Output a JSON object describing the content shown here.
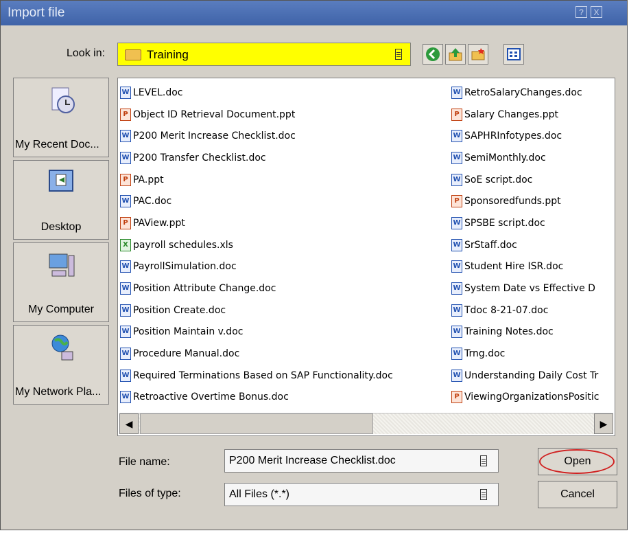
{
  "dialog": {
    "title": "Import file",
    "help_label": "?",
    "close_label": "X"
  },
  "lookin": {
    "label": "Look in:",
    "value": "Training",
    "highlight_color": "#ffff00"
  },
  "toolbar": {
    "back_icon": "back-arrow-icon",
    "up_icon": "up-folder-icon",
    "new_folder_icon": "new-folder-icon",
    "views_icon": "views-menu-icon"
  },
  "places": [
    {
      "label": "My Recent Doc...",
      "icon": "recent-documents-icon"
    },
    {
      "label": "Desktop",
      "icon": "desktop-icon"
    },
    {
      "label": "My Computer",
      "icon": "my-computer-icon"
    },
    {
      "label": "My Network Pla...",
      "icon": "network-places-icon"
    }
  ],
  "files_col1": [
    {
      "name": "LEVEL.doc",
      "type": "word"
    },
    {
      "name": "Object ID Retrieval Document.ppt",
      "type": "ppt"
    },
    {
      "name": "P200 Merit Increase Checklist.doc",
      "type": "word"
    },
    {
      "name": "P200 Transfer Checklist.doc",
      "type": "word"
    },
    {
      "name": "PA.ppt",
      "type": "ppt"
    },
    {
      "name": "PAC.doc",
      "type": "word"
    },
    {
      "name": "PAView.ppt",
      "type": "ppt"
    },
    {
      "name": "payroll schedules.xls",
      "type": "xls"
    },
    {
      "name": "PayrollSimulation.doc",
      "type": "word"
    },
    {
      "name": "Position Attribute Change.doc",
      "type": "word"
    },
    {
      "name": "Position Create.doc",
      "type": "word"
    },
    {
      "name": "Position Maintain v.doc",
      "type": "word"
    },
    {
      "name": "Procedure Manual.doc",
      "type": "word"
    },
    {
      "name": "Required Terminations Based on SAP Functionality.doc",
      "type": "word"
    },
    {
      "name": "Retroactive Overtime Bonus.doc",
      "type": "word"
    }
  ],
  "files_col2": [
    {
      "name": "RetroSalaryChanges.doc",
      "type": "word"
    },
    {
      "name": "Salary Changes.ppt",
      "type": "ppt"
    },
    {
      "name": "SAPHRInfotypes.doc",
      "type": "word"
    },
    {
      "name": "SemiMonthly.doc",
      "type": "word"
    },
    {
      "name": "SoE script.doc",
      "type": "word"
    },
    {
      "name": "Sponsoredfunds.ppt",
      "type": "ppt"
    },
    {
      "name": "SPSBE script.doc",
      "type": "word"
    },
    {
      "name": "SrStaff.doc",
      "type": "word"
    },
    {
      "name": "Student Hire ISR.doc",
      "type": "word"
    },
    {
      "name": "System Date vs Effective D",
      "type": "word"
    },
    {
      "name": "Tdoc 8-21-07.doc",
      "type": "word"
    },
    {
      "name": "Training Notes.doc",
      "type": "word"
    },
    {
      "name": "Trng.doc",
      "type": "word"
    },
    {
      "name": "Understanding Daily Cost Tr",
      "type": "word"
    },
    {
      "name": "ViewingOrganizationsPositic",
      "type": "ppt"
    }
  ],
  "scroll": {
    "left_arrow": "◀",
    "right_arrow": "▶"
  },
  "filename": {
    "label": "File name:",
    "value": "P200 Merit Increase Checklist.doc"
  },
  "filetype": {
    "label": "Files of type:",
    "value": "All Files (*.*)"
  },
  "buttons": {
    "open": "Open",
    "cancel": "Cancel"
  },
  "highlight": {
    "open_button_circle_color": "#d02020"
  }
}
